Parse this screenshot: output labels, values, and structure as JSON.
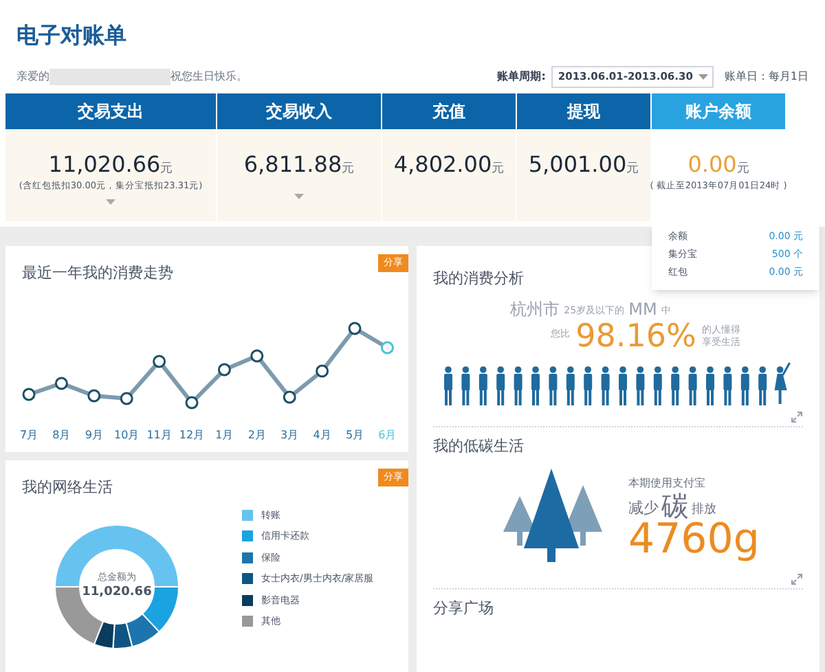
{
  "title": "电子对账单",
  "greeting": {
    "prefix": "亲爱的",
    "suffix": "祝您生日快乐。"
  },
  "period": {
    "label": "账单周期:",
    "value": "2013.06.01-2013.06.30"
  },
  "bill_day": "账单日：每月1日",
  "summary": [
    {
      "label": "交易支出",
      "amount": "11,020.66",
      "unit": "元",
      "note": "(含红包抵扣30.00元，集分宝抵扣23.31元)",
      "expandable": true,
      "selected": false
    },
    {
      "label": "交易收入",
      "amount": "6,811.88",
      "unit": "元",
      "expandable": true,
      "selected": false
    },
    {
      "label": "充值",
      "amount": "4,802.00",
      "unit": "元",
      "expandable": false,
      "selected": false
    },
    {
      "label": "提现",
      "amount": "5,001.00",
      "unit": "元",
      "expandable": false,
      "selected": false
    },
    {
      "label": "账户余额",
      "amount": "0.00",
      "unit": "元",
      "note": "( 截止至2013年07月01日24时 )",
      "expandable": false,
      "selected": true
    }
  ],
  "balance_details": [
    {
      "label": "余额",
      "value": "0.00 元"
    },
    {
      "label": "集分宝",
      "value": "500 个"
    },
    {
      "label": "红包",
      "value": "0.00 元"
    }
  ],
  "trend": {
    "title": "最近一年我的消费走势",
    "share": "分享",
    "months": [
      {
        "label": "7月",
        "selected": false
      },
      {
        "label": "8月",
        "selected": false
      },
      {
        "label": "9月",
        "selected": false
      },
      {
        "label": "10月",
        "selected": false
      },
      {
        "label": "11月",
        "selected": false
      },
      {
        "label": "12月",
        "selected": false
      },
      {
        "label": "1月",
        "selected": false
      },
      {
        "label": "2月",
        "selected": false
      },
      {
        "label": "3月",
        "selected": false
      },
      {
        "label": "4月",
        "selected": false
      },
      {
        "label": "5月",
        "selected": false
      },
      {
        "label": "6月",
        "selected": true
      }
    ]
  },
  "analysis": {
    "title": "我的消费分析",
    "city": "杭州市",
    "group": "25岁及以下的",
    "who": "MM",
    "in": "中",
    "prefix": "您比",
    "percent": "98.16%",
    "suffix_1": "的人懂得",
    "suffix_2": "享受生活"
  },
  "network": {
    "title": "我的网络生活",
    "share": "分享",
    "total_label": "总金额为",
    "total": "11,020.66",
    "legend": [
      {
        "label": "转账",
        "color": "#66c3ef"
      },
      {
        "label": "信用卡还款",
        "color": "#1aa3e0"
      },
      {
        "label": "保险",
        "color": "#1d75ad"
      },
      {
        "label": "女士内衣/男士内衣/家居服",
        "color": "#0e5585"
      },
      {
        "label": "影音电器",
        "color": "#0a3c5e"
      },
      {
        "label": "其他",
        "color": "#999999"
      }
    ]
  },
  "low_carbon": {
    "title": "我的低碳生活",
    "line1": "本期使用支付宝",
    "reduce": "减少",
    "carbon": "碳",
    "emission": "排放",
    "amount": "4760g"
  },
  "share_plaza": {
    "title": "分享广场"
  }
}
